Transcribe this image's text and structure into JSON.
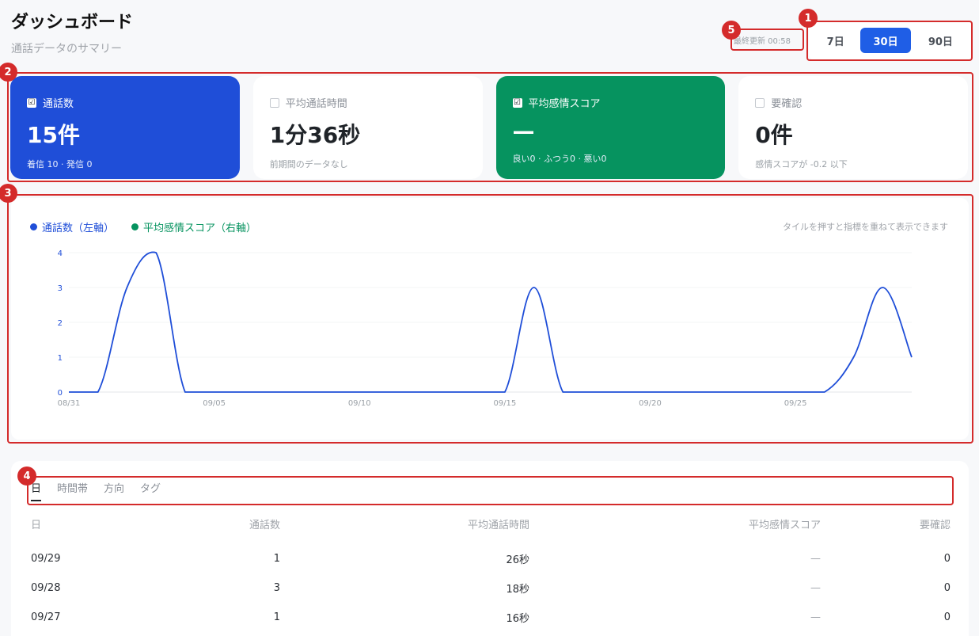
{
  "header": {
    "title": "ダッシュボード",
    "subtitle": "通話データのサマリー",
    "last_updated": "最終更新 00:58"
  },
  "range": {
    "options": [
      "7日",
      "30日",
      "90日"
    ],
    "selected": "30日"
  },
  "tiles": [
    {
      "label": "通話数",
      "value": "15件",
      "sub": "着信 10 · 発信 0",
      "checked": true,
      "color": "#1f4ed8",
      "check": "☑"
    },
    {
      "label": "平均通話時間",
      "value": "1分36秒",
      "sub": "前期間のデータなし",
      "checked": false,
      "check": ""
    },
    {
      "label": "平均感情スコア",
      "value": "—",
      "sub": "良い0 · ふつう0 · 悪い0",
      "checked": true,
      "color": "#06935f",
      "check": "☑"
    },
    {
      "label": "要確認",
      "value": "0件",
      "sub": "感情スコアが -0.2 以下",
      "checked": false,
      "check": ""
    }
  ],
  "chart": {
    "legend": [
      {
        "name": "通話数（左軸）",
        "color": "#1f4ed8"
      },
      {
        "name": "平均感情スコア（右軸）",
        "color": "#06935f"
      }
    ],
    "hint": "タイルを押すと指標を重ねて表示できます"
  },
  "chart_data": {
    "type": "line",
    "x": [
      "08/31",
      "09/01",
      "09/02",
      "09/03",
      "09/04",
      "09/05",
      "09/06",
      "09/07",
      "09/08",
      "09/09",
      "09/10",
      "09/11",
      "09/12",
      "09/13",
      "09/14",
      "09/15",
      "09/16",
      "09/17",
      "09/18",
      "09/19",
      "09/20",
      "09/21",
      "09/22",
      "09/23",
      "09/24",
      "09/25",
      "09/26",
      "09/27",
      "09/28",
      "09/29"
    ],
    "series": [
      {
        "name": "通話数（左軸）",
        "color": "#1f4ed8",
        "values": [
          0,
          0,
          3,
          4,
          0,
          0,
          0,
          0,
          0,
          0,
          0,
          0,
          0,
          0,
          0,
          0,
          3,
          0,
          0,
          0,
          0,
          0,
          0,
          0,
          0,
          0,
          0,
          1,
          3,
          1
        ]
      }
    ],
    "x_tick_labels": [
      "08/31",
      "09/05",
      "09/10",
      "09/15",
      "09/20",
      "09/25"
    ],
    "y_ticks": [
      0,
      1,
      2,
      3,
      4
    ],
    "ylim": [
      0,
      4
    ],
    "grid": true
  },
  "table": {
    "tabs": [
      "日",
      "時間帯",
      "方向",
      "タグ"
    ],
    "active_tab": "日",
    "columns": [
      "日",
      "通話数",
      "平均通話時間",
      "平均感情スコア",
      "要確認"
    ],
    "rows": [
      {
        "date": "09/29",
        "calls": "1",
        "avg_duration": "26秒",
        "sentiment": "—",
        "review": "0"
      },
      {
        "date": "09/28",
        "calls": "3",
        "avg_duration": "18秒",
        "sentiment": "—",
        "review": "0"
      },
      {
        "date": "09/27",
        "calls": "1",
        "avg_duration": "16秒",
        "sentiment": "—",
        "review": "0"
      }
    ]
  },
  "annotations": [
    "1",
    "2",
    "3",
    "4",
    "5"
  ]
}
